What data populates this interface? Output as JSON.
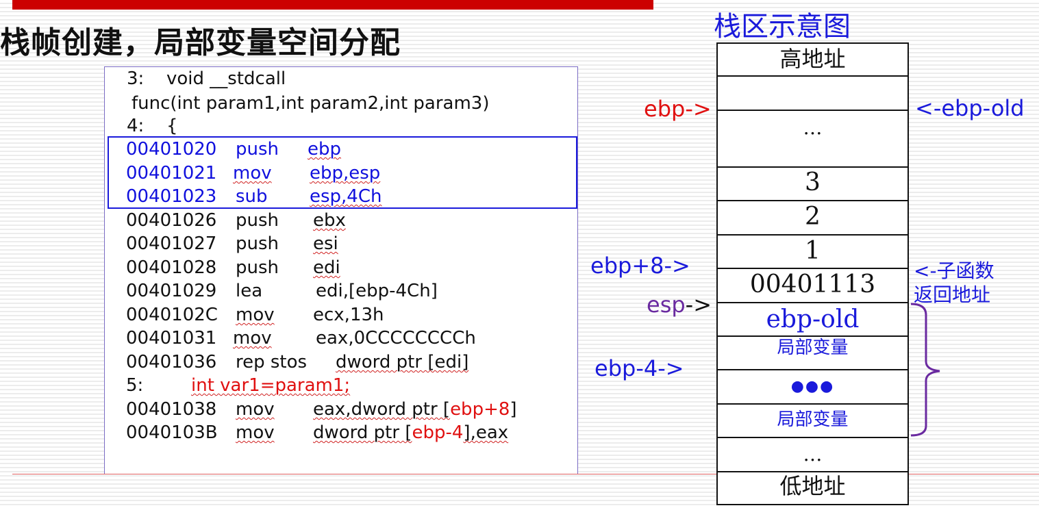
{
  "slide": {
    "title": "栈帧创建，局部变量空间分配",
    "accent_color": "#cc0000"
  },
  "code": {
    "line1": {
      "num": "3:",
      "text": "void __stdcall"
    },
    "line2": {
      "text": "func(int param1,int param2,int param3)"
    },
    "line3": {
      "num": "4:",
      "text": "{"
    },
    "instructions_highlighted": [
      {
        "addr": "00401020",
        "op": "push",
        "arg": "ebp"
      },
      {
        "addr": "00401021",
        "op": "mov",
        "arg": "ebp,esp"
      },
      {
        "addr": "00401023",
        "op": "sub",
        "arg": "esp,4Ch"
      }
    ],
    "instructions": [
      {
        "addr": "00401026",
        "op": "push",
        "arg": "ebx"
      },
      {
        "addr": "00401027",
        "op": "push",
        "arg": "esi"
      },
      {
        "addr": "00401028",
        "op": "push",
        "arg": "edi"
      },
      {
        "addr": "00401029",
        "op": "lea",
        "arg": "edi,[ebp-4Ch]"
      },
      {
        "addr": "0040102C",
        "op": "mov",
        "arg": "ecx,13h"
      },
      {
        "addr": "00401031",
        "op": "mov",
        "arg": "eax,0CCCCCCCCh"
      },
      {
        "addr": "00401036",
        "op": "rep stos",
        "arg": "dword ptr [edi]"
      }
    ],
    "line5": {
      "num": "5:",
      "text": "int var1=param1;"
    },
    "mov1": {
      "addr": "00401038",
      "op": "mov",
      "arg_pre": "eax,dword ptr [",
      "arg_red": "ebp+8",
      "arg_post": "]"
    },
    "mov2": {
      "addr": "0040103B",
      "op": "mov",
      "arg_pre": "dword ptr [",
      "arg_red": "ebp-4",
      "arg_post": "],eax"
    }
  },
  "stack_diagram": {
    "title": "栈区示意图",
    "cells": [
      "高地址",
      "",
      "…",
      "3",
      "2",
      "1",
      "00401113",
      "ebp-old",
      "局部变量",
      "●●●",
      "局部变量",
      "…",
      "低地址"
    ],
    "pointers": {
      "ebp": "ebp->",
      "ebp_old": "<-ebp-old",
      "ebp_plus8": "ebp+8->",
      "esp_name": "esp",
      "esp_arrow": "->",
      "ebp_minus4": "ebp-4->"
    },
    "return_note_line1": "<-子函数",
    "return_note_line2": "返回地址"
  },
  "colors": {
    "blue": "#1a1adb",
    "red": "#e01010",
    "purple": "#6a2aa0"
  }
}
